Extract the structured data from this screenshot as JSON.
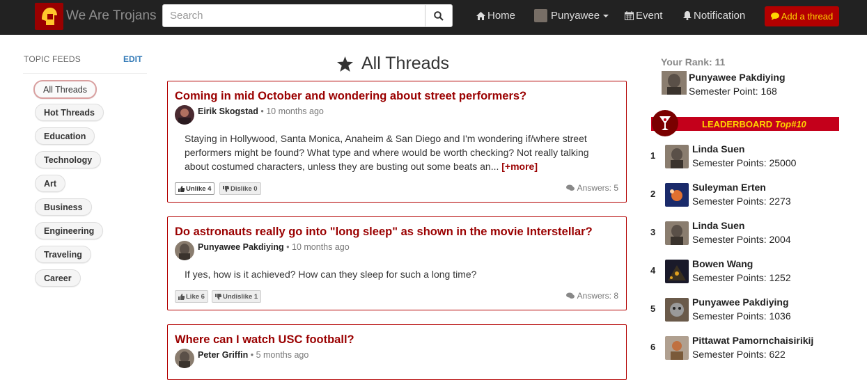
{
  "navbar": {
    "brand": "We Are Trojans",
    "search_placeholder": "Search",
    "home": "Home",
    "user": "Punyawee",
    "event": "Event",
    "notification": "Notification",
    "add_thread": "Add a thread",
    "colors": {
      "bar": "#222222",
      "accent": "#b30000",
      "accent_text": "#ffd500"
    }
  },
  "sidebar": {
    "heading": "TOPIC FEEDS",
    "edit": "EDIT",
    "topics": [
      "All Threads",
      "Hot Threads",
      "Education",
      "Technology",
      "Art",
      "Business",
      "Engineering",
      "Traveling",
      "Career"
    ],
    "active": "All Threads"
  },
  "main": {
    "title": "All Threads",
    "threads": [
      {
        "title": "Coming in mid October and wondering about street performers?",
        "author": "Eirik Skogstad",
        "time": "10 months ago",
        "body": "Staying in Hollywood, Santa Monica, Anaheim & San Diego and I'm wondering if/where street performers might be found? What type and where would be worth checking? Not really talking about costumed characters, unless they are busting out some beats an...",
        "more": "[+more]",
        "vote1": "Unlike 4",
        "vote2": "Dislike 0",
        "answers": "Answers: 5"
      },
      {
        "title": "Do astronauts really go into \"long sleep\" as shown in the movie Interstellar?",
        "author": "Punyawee Pakdiying",
        "time": "10 months ago",
        "body": "If yes, how is it achieved? How can they sleep for such a long time?",
        "vote1": "Like 6",
        "vote2": "Undislike 1",
        "answers": "Answers: 8"
      },
      {
        "title": "Where can I watch USC football?",
        "author": "Peter Griffin",
        "time": "5 months ago"
      }
    ]
  },
  "rank": {
    "label": "Your Rank: 11",
    "name": "Punyawee Pakdiying",
    "points": "Semester Point: 168"
  },
  "leaderboard": {
    "title": "LEADERBOARD",
    "suffix": "Top#10",
    "entries": [
      {
        "rank": "1",
        "name": "Linda Suen",
        "points": "Semester Points: 25000"
      },
      {
        "rank": "2",
        "name": "Suleyman Erten",
        "points": "Semester Points: 2273"
      },
      {
        "rank": "3",
        "name": "Linda Suen",
        "points": "Semester Points: 2004"
      },
      {
        "rank": "4",
        "name": "Bowen Wang",
        "points": "Semester Points: 1252"
      },
      {
        "rank": "5",
        "name": "Punyawee Pakdiying",
        "points": "Semester Points: 1036"
      },
      {
        "rank": "6",
        "name": "Pittawat Pamornchaisirikij",
        "points": "Semester Points: 622"
      }
    ]
  }
}
